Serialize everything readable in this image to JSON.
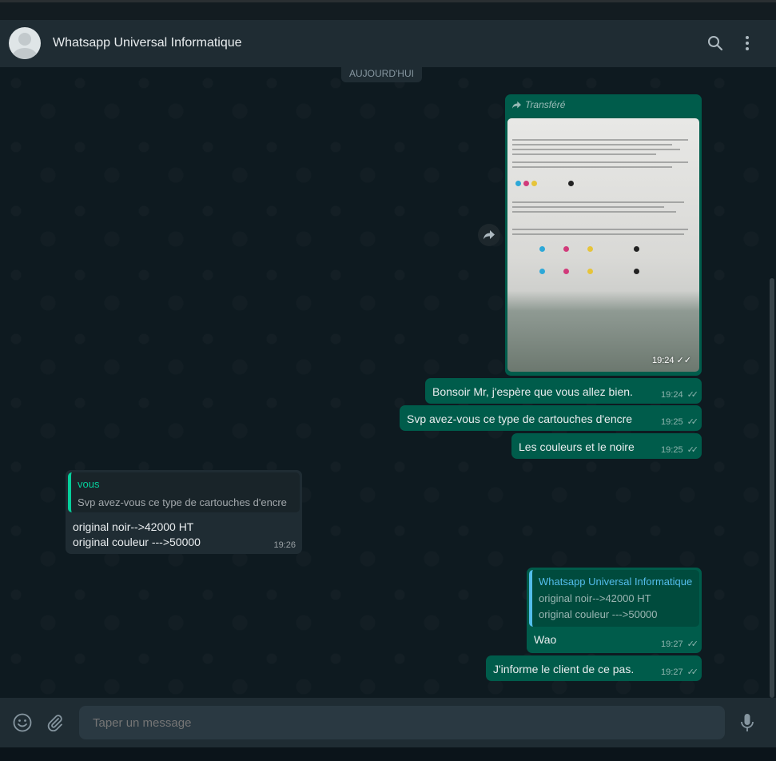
{
  "header": {
    "contact_name": "Whatsapp Universal Informatique",
    "icons": [
      "avatar",
      "search-icon",
      "menu-icon"
    ]
  },
  "chat": {
    "day_label": "AUJOURD'HUI",
    "image_message": {
      "forwarded_label": "Transféré",
      "time": "19:24",
      "status": "read"
    },
    "messages": [
      {
        "direction": "out",
        "text": "Bonsoir Mr, j'espère que vous allez bien.",
        "time": "19:24",
        "status": "read"
      },
      {
        "direction": "out",
        "text": "Svp avez-vous ce type de cartouches d'encre",
        "time": "19:25",
        "status": "read"
      },
      {
        "direction": "out",
        "text": "Les couleurs et le noire",
        "time": "19:25",
        "status": "read"
      },
      {
        "direction": "in",
        "quote_author": "vous",
        "quote_text": "Svp avez-vous ce type de cartouches d'encre",
        "text": "original noir-->42000 HT\noriginal couleur --->50000",
        "time": "19:26"
      },
      {
        "direction": "out",
        "quote_author": "Whatsapp Universal Informatique",
        "quote_text": "original noir-->42000 HT\noriginal couleur --->50000",
        "text": "Wao",
        "time": "19:27",
        "status": "read"
      },
      {
        "direction": "out",
        "text": "J'informe le client de ce pas.",
        "time": "19:27",
        "status": "read"
      }
    ]
  },
  "composer": {
    "placeholder": "Taper un message",
    "icons": [
      "emoji-icon",
      "attach-icon",
      "mic-icon"
    ]
  },
  "colors": {
    "outgoing_bubble": "#005c4b",
    "incoming_bubble": "#1f2c33",
    "header": "#1f2c33",
    "accent_green": "#06cf9c",
    "accent_blue": "#53bdeb"
  }
}
